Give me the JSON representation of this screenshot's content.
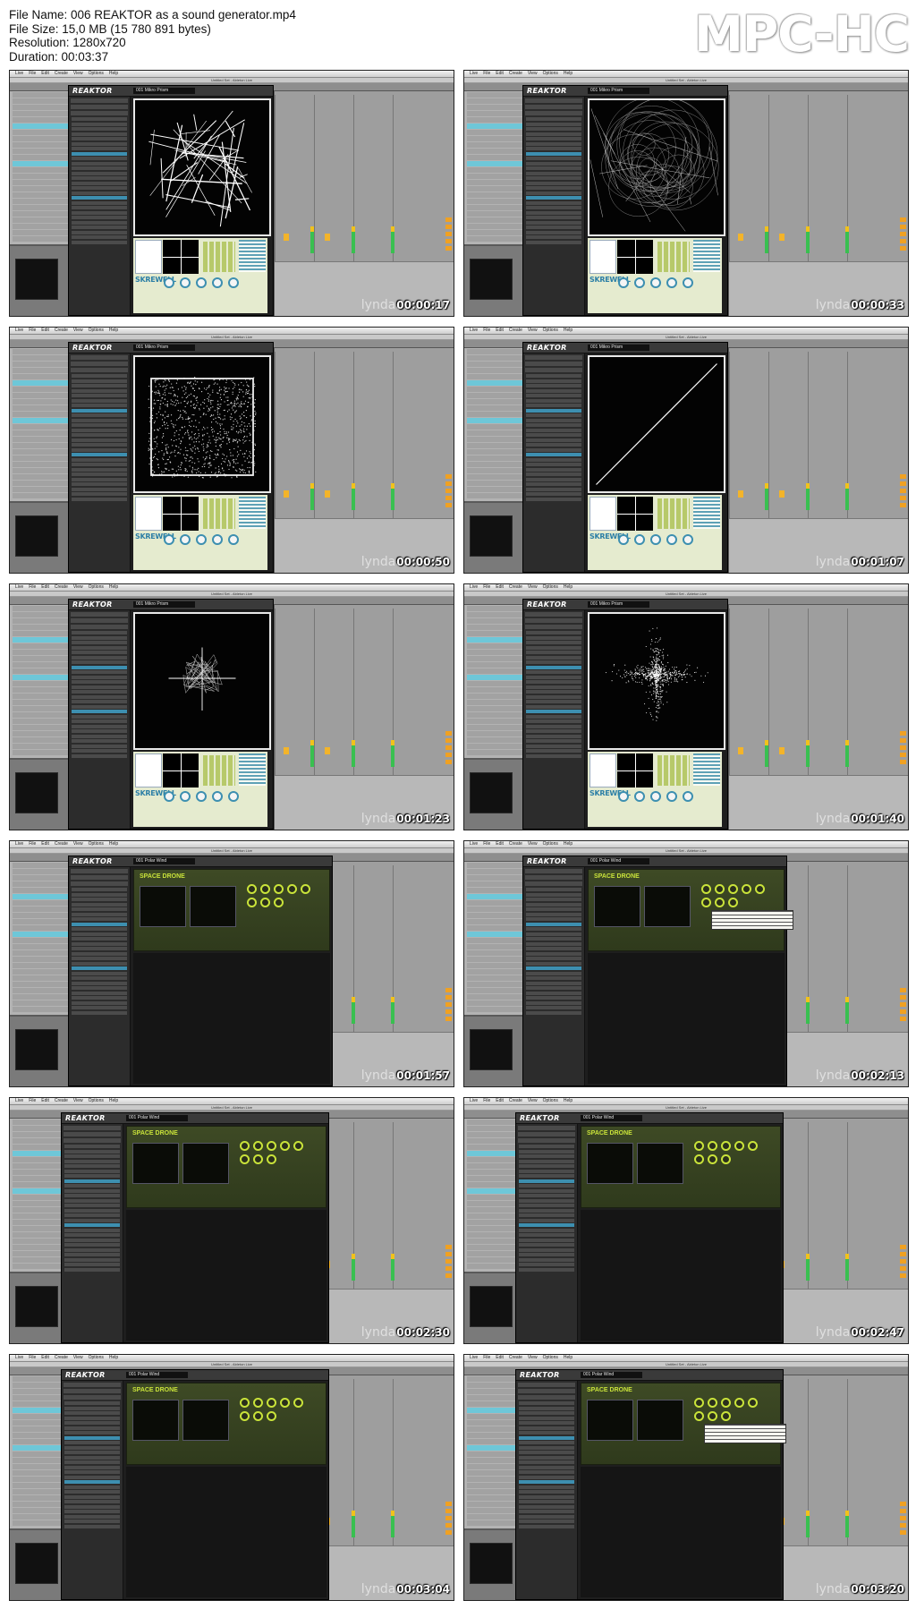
{
  "file_info": {
    "name_line": "File Name: 006 REAKTOR as a sound generator.mp4",
    "size_line": "File Size: 15,0 MB (15 780 891 bytes)",
    "resolution_line": "Resolution: 1280x720",
    "duration_line": "Duration: 00:03:37"
  },
  "player_brand": "MPC-HC",
  "menubar": [
    "Live",
    "File",
    "Edit",
    "Create",
    "View",
    "Options",
    "Help"
  ],
  "window_title": "Untitled Set - Ableton Live",
  "app_logo": "REAKTOR",
  "panel_logo": "SKREWELL",
  "ensemble_logo": "SPACE DRONE",
  "watermark": "lynda",
  "frames": [
    {
      "timestamp": "00:00:17",
      "instrument": "001 Mikro Prism",
      "scene": "lines",
      "layout": "skrewell"
    },
    {
      "timestamp": "00:00:33",
      "instrument": "001 Mikro Prism",
      "scene": "swirl",
      "layout": "skrewell"
    },
    {
      "timestamp": "00:00:50",
      "instrument": "001 Mikro Prism",
      "scene": "cloud",
      "layout": "skrewell"
    },
    {
      "timestamp": "00:01:07",
      "instrument": "001 Mikro Prism",
      "scene": "diagonal",
      "layout": "skrewell"
    },
    {
      "timestamp": "00:01:23",
      "instrument": "001 Mikro Prism",
      "scene": "scribble",
      "layout": "skrewell"
    },
    {
      "timestamp": "00:01:40",
      "instrument": "001 Mikro Prism",
      "scene": "cross",
      "layout": "skrewell"
    },
    {
      "timestamp": "00:01:57",
      "instrument": "001 Polar Wind",
      "scene": "ensemble",
      "layout": "ensemble"
    },
    {
      "timestamp": "00:02:13",
      "instrument": "001 Polar Wind",
      "scene": "ensemble",
      "layout": "ensemble"
    },
    {
      "timestamp": "00:02:30",
      "instrument": "001 Polar Wind",
      "scene": "ensemble",
      "layout": "ensemble"
    },
    {
      "timestamp": "00:02:47",
      "instrument": "001 Polar Wind",
      "scene": "ensemble",
      "layout": "ensemble"
    },
    {
      "timestamp": "00:03:04",
      "instrument": "001 Polar Wind",
      "scene": "ensemble",
      "layout": "ensemble"
    },
    {
      "timestamp": "00:03:20",
      "instrument": "001 Polar Wind",
      "scene": "ensemble",
      "layout": "ensemble"
    }
  ],
  "colors": {
    "accent_blue": "#3d8fb0",
    "ableton_cyan": "#6ec7d8",
    "ensemble_green": "#c9e33a",
    "meter_green": "#39c050",
    "meter_yellow": "#f1c21b"
  }
}
